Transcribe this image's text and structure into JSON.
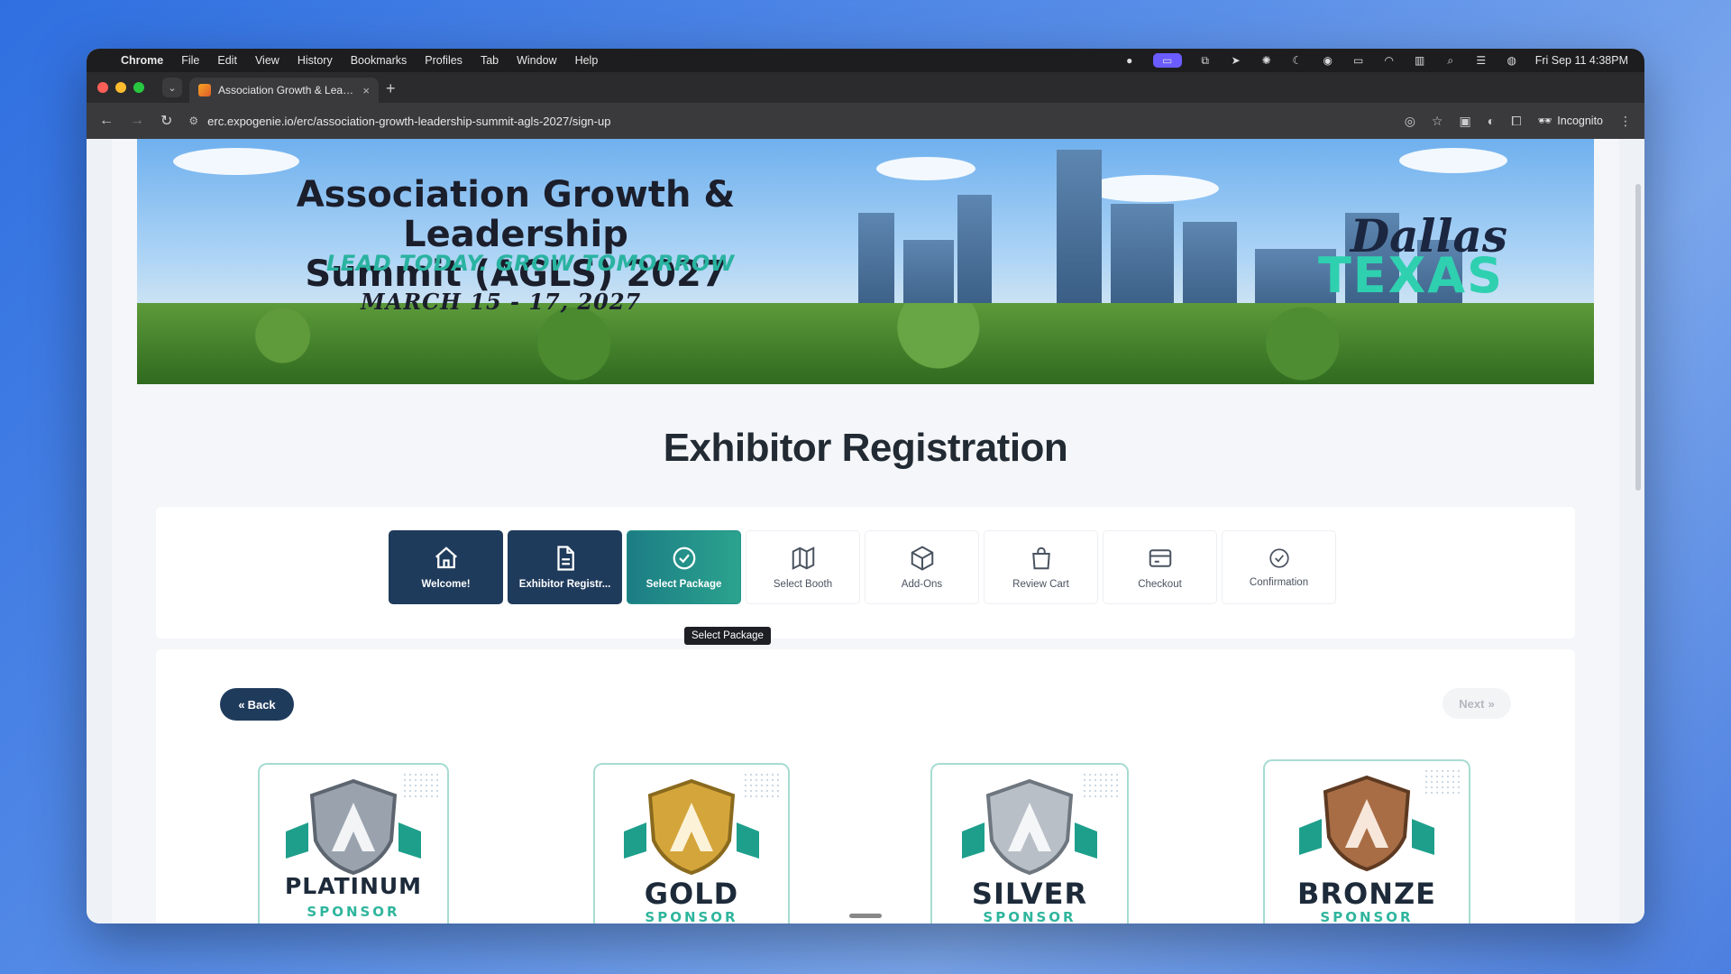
{
  "menubar": {
    "app": "Chrome",
    "items": [
      "File",
      "Edit",
      "View",
      "History",
      "Bookmarks",
      "Profiles",
      "Tab",
      "Window",
      "Help"
    ],
    "datetime": "Fri Sep 11  4:38PM"
  },
  "tab": {
    "title": "Association Growth & Leader",
    "close": "×",
    "new": "+"
  },
  "address": {
    "url": "erc.expogenie.io/erc/association-growth-leadership-summit-agls-2027/sign-up",
    "incognito": "Incognito"
  },
  "banner": {
    "title_line1": "Association Growth & Leadership",
    "title_line2": "Summit (AGLS) 2027",
    "tagline": "LEAD TODAY. GROW TOMORROW",
    "dates": "MARCH 15 - 17, 2027",
    "city": "Dallas",
    "state": "TEXAS"
  },
  "page": {
    "title": "Exhibitor Registration"
  },
  "steps": [
    {
      "label": "Welcome!",
      "icon": "home-icon",
      "state": "done"
    },
    {
      "label": "Exhibitor Registr...",
      "icon": "document-icon",
      "state": "done"
    },
    {
      "label": "Select Package",
      "icon": "check-circle-icon",
      "state": "current"
    },
    {
      "label": "Select Booth",
      "icon": "map-icon",
      "state": "pending"
    },
    {
      "label": "Add-Ons",
      "icon": "package-icon",
      "state": "pending"
    },
    {
      "label": "Review Cart",
      "icon": "bag-icon",
      "state": "pending"
    },
    {
      "label": "Checkout",
      "icon": "card-icon",
      "state": "pending"
    },
    {
      "label": "Confirmation",
      "icon": "check-circle-icon",
      "state": "pending"
    }
  ],
  "tooltip": "Select Package",
  "nav": {
    "back": "Back",
    "next": "Next"
  },
  "packages": [
    {
      "name": "PLATINUM",
      "sub": "SPONSOR",
      "color": "#9aa3ad"
    },
    {
      "name": "GOLD",
      "sub": "SPONSOR",
      "color": "#d4a53a"
    },
    {
      "name": "SILVER",
      "sub": "SPONSOR",
      "color": "#b8bfc7"
    },
    {
      "name": "BRONZE",
      "sub": "SPONSOR",
      "color": "#a86d45"
    }
  ],
  "colors": {
    "primary": "#1f3b5c",
    "accent": "#2ba38e",
    "teal": "#2fd0b0"
  }
}
